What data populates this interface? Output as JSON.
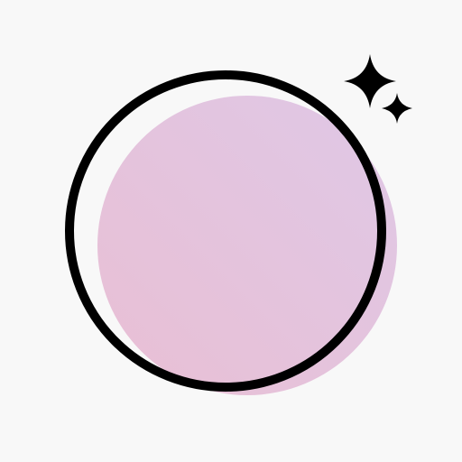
{
  "icon": {
    "background_color": "#f8f8f8",
    "outline_color": "#000000",
    "fill_gradient": {
      "start": "#e9bfd4",
      "end": "#dfc8e6"
    },
    "elements": [
      {
        "name": "pink-disc",
        "type": "filled-circle"
      },
      {
        "name": "ring-outline",
        "type": "stroked-circle"
      },
      {
        "name": "large-sparkle-icon",
        "type": "four-point-star"
      },
      {
        "name": "small-sparkle-icon",
        "type": "four-point-star"
      }
    ]
  }
}
